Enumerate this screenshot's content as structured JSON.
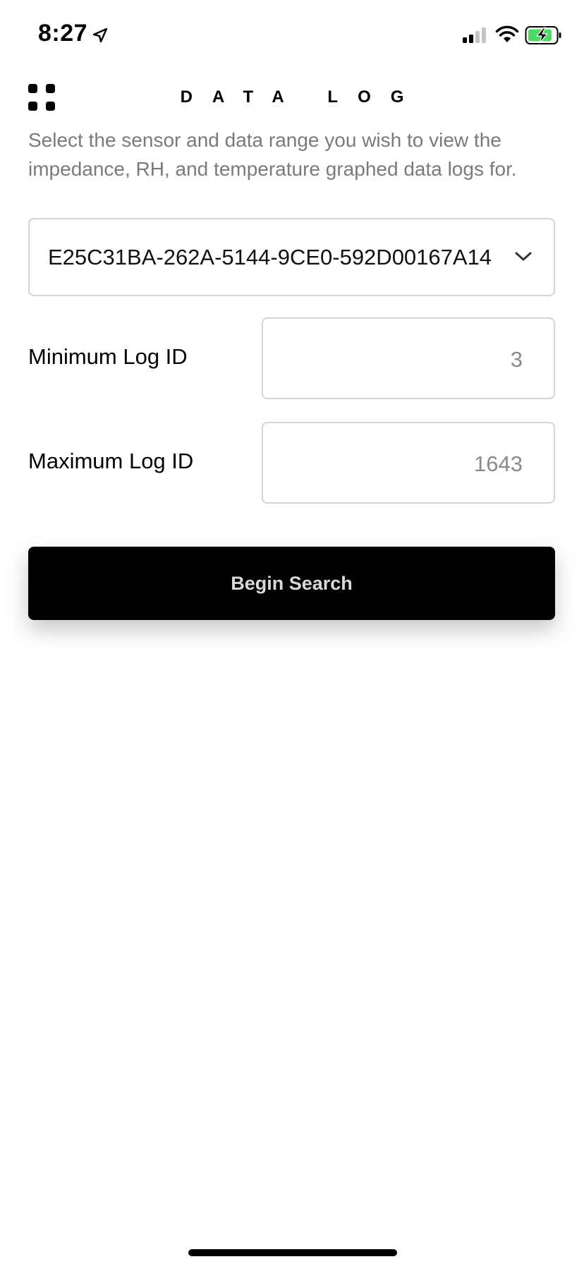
{
  "status_bar": {
    "time": "8:27",
    "battery_color": "#4cd964"
  },
  "header": {
    "title": "DATA LOG"
  },
  "instructions": "Select the sensor and data range you wish to view the impedance, RH, and temperature graphed data logs for.",
  "sensor_select": {
    "value": "E25C31BA-262A-5144-9CE0-592D00167A14"
  },
  "min_log": {
    "label": "Minimum Log ID",
    "value": "3"
  },
  "max_log": {
    "label": "Maximum Log ID",
    "value": "1643"
  },
  "search_button": {
    "label": "Begin Search"
  }
}
